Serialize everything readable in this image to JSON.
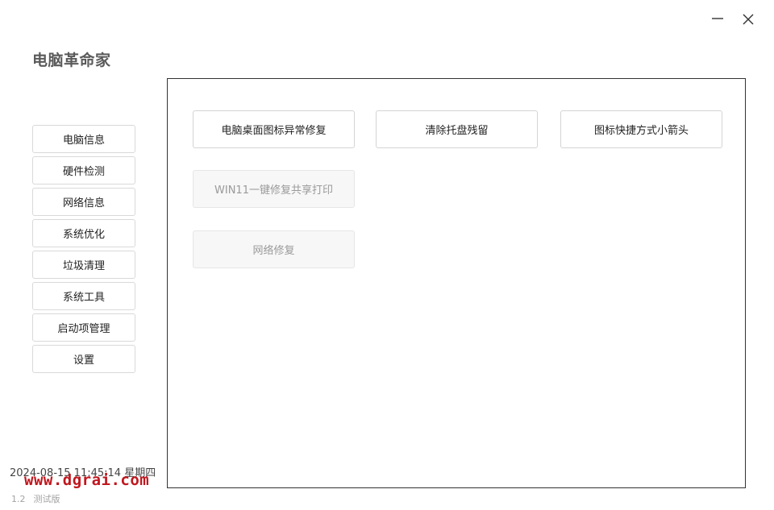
{
  "window_controls": {
    "minimize_icon": "minimize-icon",
    "close_icon": "close-icon"
  },
  "app": {
    "title": "电脑革命家"
  },
  "sidebar": {
    "items": [
      {
        "label": "电脑信息"
      },
      {
        "label": "硬件检测"
      },
      {
        "label": "网络信息"
      },
      {
        "label": "系统优化"
      },
      {
        "label": "垃圾清理"
      },
      {
        "label": "系统工具"
      },
      {
        "label": "启动项管理"
      },
      {
        "label": "设置"
      }
    ]
  },
  "main": {
    "buttons": [
      {
        "label": "电脑桌面图标异常修复",
        "enabled": true
      },
      {
        "label": "清除托盘残留",
        "enabled": true
      },
      {
        "label": "图标快捷方式小箭头",
        "enabled": true
      },
      {
        "label": "WIN11一键修复共享打印",
        "enabled": false
      },
      {
        "label": "网络修复",
        "enabled": false
      }
    ]
  },
  "footer": {
    "datetime": "2024-08-15 11:45:14 星期四",
    "watermark": "www.dgrai.com",
    "version": "1.2",
    "edition": "测试版"
  },
  "colors": {
    "watermark": "#c0171e",
    "title": "#5a5a5a",
    "panel_border": "#333333"
  }
}
